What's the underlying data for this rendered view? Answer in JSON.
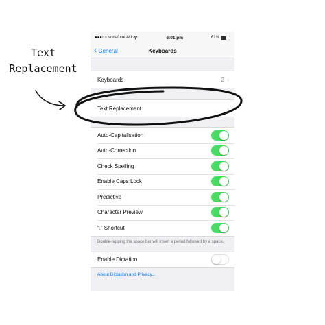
{
  "annotation": {
    "line1": "Text",
    "line2": "Replacement"
  },
  "status_bar": {
    "carrier": "vodafone AU",
    "time": "6:01 pm",
    "battery": "61%",
    "battery_level": 0.61
  },
  "nav": {
    "back_label": "General",
    "title": "Keyboards"
  },
  "group1": [
    {
      "label": "Keyboards",
      "value": "2"
    },
    {
      "label": "Text Replacement",
      "value": ""
    }
  ],
  "toggles": [
    {
      "label": "Auto-Capitalisation",
      "on": true
    },
    {
      "label": "Auto-Correction",
      "on": true
    },
    {
      "label": "Check Spelling",
      "on": true
    },
    {
      "label": "Enable Caps Lock",
      "on": true
    },
    {
      "label": "Predictive",
      "on": true
    },
    {
      "label": "Character Preview",
      "on": true
    },
    {
      "label": "“.” Shortcut",
      "on": true
    }
  ],
  "shortcut_footnote": "Double-tapping the space bar will insert a period followed by a space.",
  "dictation": {
    "label": "Enable Dictation",
    "on": false
  },
  "dictation_link": "About Dictation and Privacy...",
  "colors": {
    "accent": "#007aff",
    "toggle_on": "#4cd964",
    "background": "#efeff4"
  },
  "icons": [
    "wifi-icon",
    "signal-icon",
    "battery-icon",
    "chevron-left-icon",
    "chevron-right-icon"
  ]
}
